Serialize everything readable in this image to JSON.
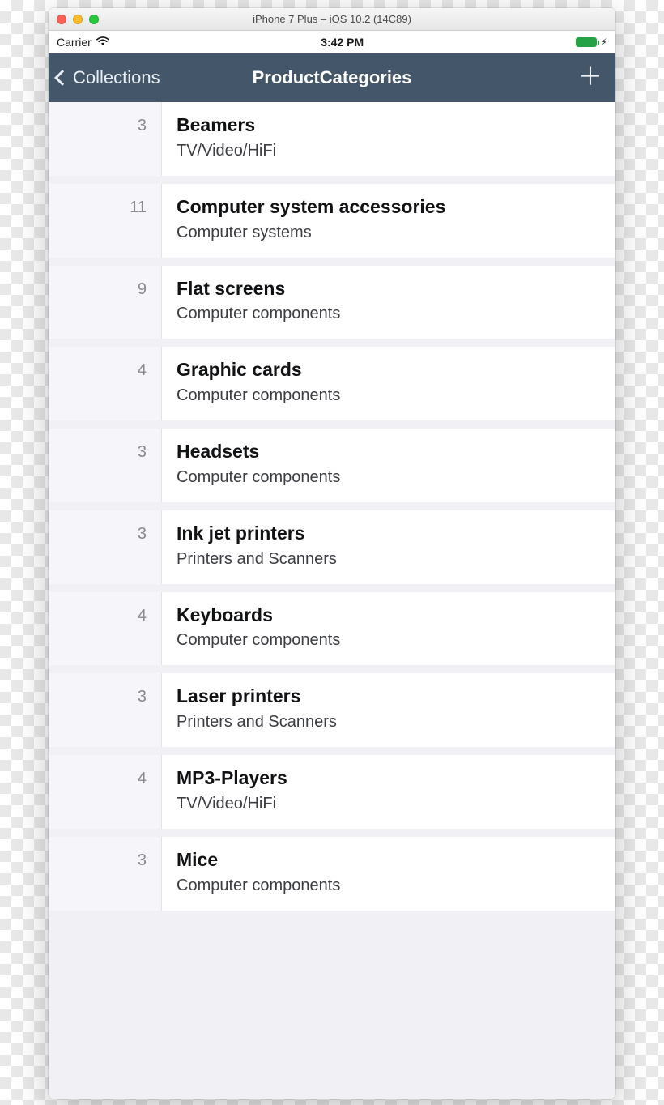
{
  "window": {
    "title": "iPhone 7 Plus – iOS 10.2 (14C89)"
  },
  "statusbar": {
    "carrier": "Carrier",
    "time": "3:42 PM",
    "bolt": "⚡︎"
  },
  "nav": {
    "back_label": "Collections",
    "title": "ProductCategories",
    "add_glyph": "＋"
  },
  "list": {
    "items": [
      {
        "count": "3",
        "title": "Beamers",
        "subtitle": "TV/Video/HiFi"
      },
      {
        "count": "11",
        "title": "Computer system accessories",
        "subtitle": "Computer systems"
      },
      {
        "count": "9",
        "title": "Flat screens",
        "subtitle": "Computer components"
      },
      {
        "count": "4",
        "title": "Graphic cards",
        "subtitle": "Computer components"
      },
      {
        "count": "3",
        "title": "Headsets",
        "subtitle": "Computer components"
      },
      {
        "count": "3",
        "title": "Ink jet printers",
        "subtitle": "Printers and Scanners"
      },
      {
        "count": "4",
        "title": "Keyboards",
        "subtitle": "Computer components"
      },
      {
        "count": "3",
        "title": "Laser printers",
        "subtitle": "Printers and Scanners"
      },
      {
        "count": "4",
        "title": "MP3-Players",
        "subtitle": "TV/Video/HiFi"
      },
      {
        "count": "3",
        "title": "Mice",
        "subtitle": "Computer components"
      }
    ]
  }
}
